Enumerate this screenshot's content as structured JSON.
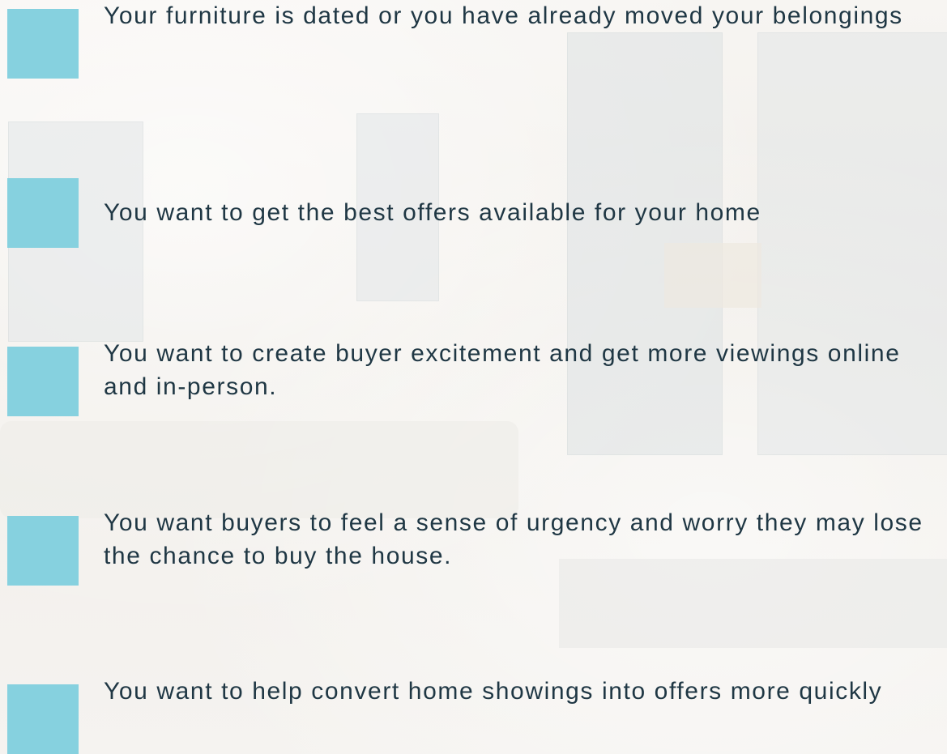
{
  "features": [
    {
      "text": "Your furniture is dated or you have already moved your belongings"
    },
    {
      "text": "You want to get the best offers available for your home"
    },
    {
      "text": "You want to create buyer excitement and get more viewings online and in-person."
    },
    {
      "text": "You want buyers to feel a sense of urgency and worry they may lose the chance to buy the house."
    },
    {
      "text": "You want to help convert home showings into offers more quickly"
    }
  ],
  "colors": {
    "square": "#86d1df",
    "text": "#1f3744",
    "background": "#f4f1ee"
  }
}
